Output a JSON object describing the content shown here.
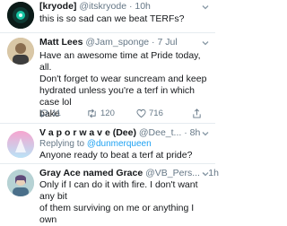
{
  "colors": {
    "link": "#1da1f2",
    "muted": "#657786",
    "text": "#14171a",
    "divider": "#e6ecf0"
  },
  "tweets": [
    {
      "display_name": "[kryode]",
      "meta": "@itskryode · 10h",
      "text": "this is so sad can we beat TERFs?"
    },
    {
      "display_name": "Matt Lees",
      "meta": "@Jam_sponge · 7 Jul",
      "text_lines": [
        "Have an awesome time at Pride today, all.",
        "Don't forget to wear suncream and keep",
        "hydrated unless you're a terf in which case lol",
        "bake"
      ],
      "actions": {
        "replies": "11",
        "retweets": "120",
        "likes": "716"
      }
    },
    {
      "display_name": "V a p o r w a v e (Dee)",
      "meta": "@Dee_t... · 8h",
      "reply_prefix": "Replying to ",
      "reply_handle": "@dunmerqueen",
      "text": "Anyone ready to beat a terf at pride?"
    },
    {
      "display_name": "Gray Ace named Grace",
      "meta": "@VB_Pers... · 1h",
      "text_lines": [
        "Only if I can do it with fire. I don't want any bit",
        "of them surviving on me or anything I own"
      ]
    }
  ]
}
